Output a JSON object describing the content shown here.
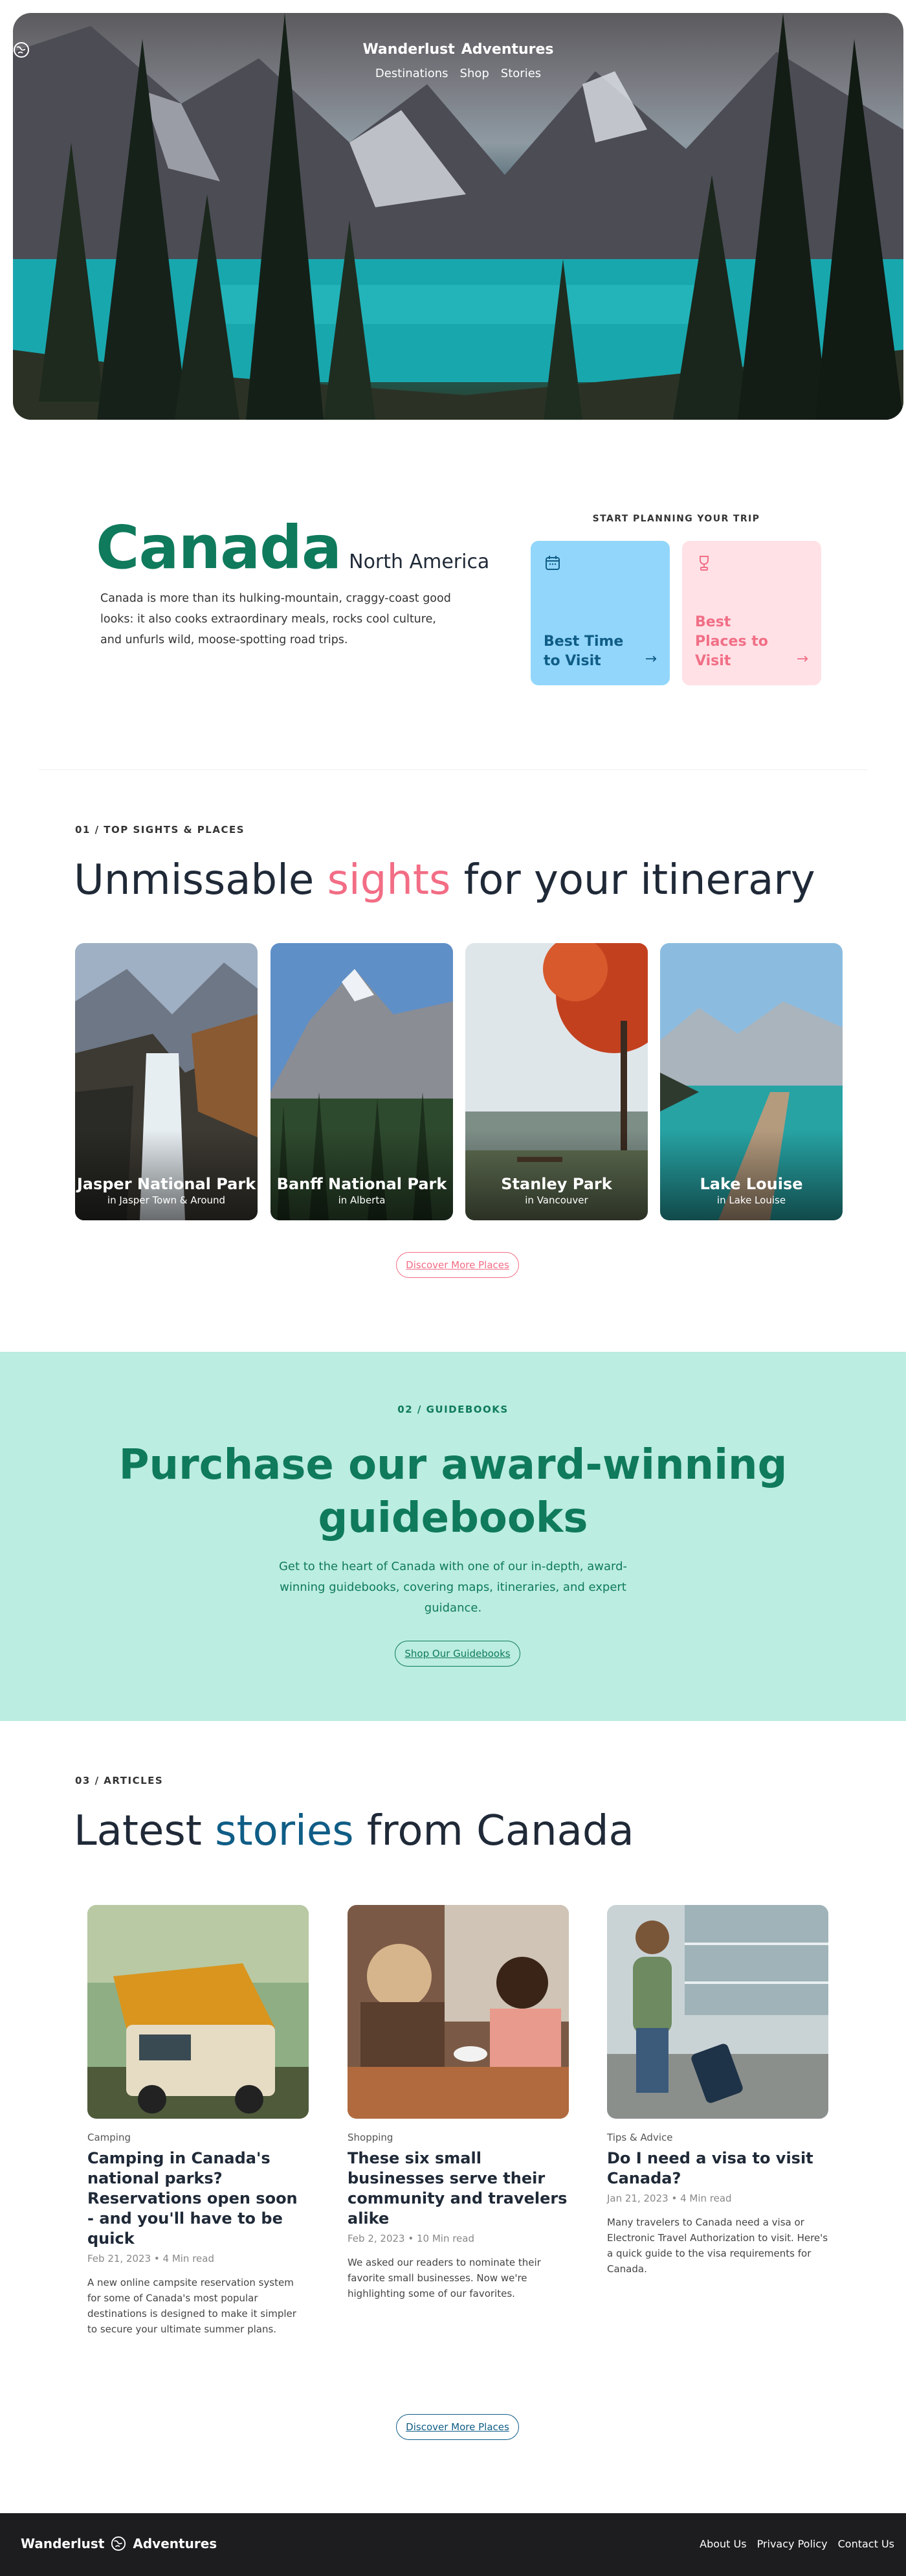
{
  "brand": {
    "name_left": "Wanderlust",
    "name_right": "Adventures"
  },
  "nav": {
    "items": [
      "Destinations",
      "Shop",
      "Stories"
    ]
  },
  "intro": {
    "country": "Canada",
    "region": "North America",
    "description": "Canada is more than its hulking-mountain, craggy-coast good looks: it also cooks extraordinary meals, rocks cool culture, and unfurls wild, moose-spotting road trips."
  },
  "planning": {
    "label": "START PLANNING YOUR TRIP",
    "cards": [
      {
        "title": "Best Time to Visit",
        "icon": "calendar-icon",
        "color": "#93d6fb"
      },
      {
        "title": "Best Places to Visit",
        "icon": "trophy-icon",
        "color": "#ffe1e6"
      }
    ]
  },
  "sights": {
    "eyebrow": "01 / TOP SIGHTS & PLACES",
    "title_before": "Unmissable ",
    "title_accent": "sights",
    "title_after": " for your itinerary",
    "items": [
      {
        "name": "Jasper National Park",
        "location": "in Jasper Town & Around"
      },
      {
        "name": "Banff National Park",
        "location": "in Alberta"
      },
      {
        "name": "Stanley Park",
        "location": "in Vancouver"
      },
      {
        "name": "Lake Louise",
        "location": "in Lake Louise"
      }
    ],
    "button": "Discover More Places"
  },
  "guidebooks": {
    "eyebrow": "02 / GUIDEBOOKS",
    "title_line1": "Purchase our award-winning",
    "title_line2": "guidebooks",
    "text": "Get to the heart of Canada with one of our in-depth, award-winning guidebooks, covering maps, itineraries, and expert guidance.",
    "button": "Shop Our Guidebooks"
  },
  "articles": {
    "eyebrow": "03 / ARTICLES",
    "title_before": "Latest ",
    "title_accent": "stories",
    "title_after": " from Canada",
    "items": [
      {
        "category": "Camping",
        "title": "Camping in Canada's national parks? Reservations open soon - and you'll have to be quick",
        "date": "Feb 21, 2023",
        "read": "4 Min read",
        "excerpt": "A new online campsite reservation system for some of Canada's most popular destinations is designed to make it simpler to secure your ultimate summer plans."
      },
      {
        "category": "Shopping",
        "title": "These six small businesses serve their community and travelers alike",
        "date": "Feb 2, 2023",
        "read": "10 Min read",
        "excerpt": "We asked our readers to nominate their favorite small businesses. Now we're highlighting some of our favorites."
      },
      {
        "category": "Tips & Advice",
        "title": "Do I need a visa to visit Canada?",
        "date": "Jan 21, 2023",
        "read": "4 Min read",
        "excerpt": "Many travelers to Canada need a visa or Electronic Travel Authorization to visit. Here's a quick guide to the visa requirements for Canada."
      }
    ],
    "button": "Discover More Places"
  },
  "footer": {
    "links": [
      "About Us",
      "Privacy Policy",
      "Contact Us"
    ]
  },
  "colors": {
    "green": "#0f7a5c",
    "pink": "#f26d85",
    "blue": "#0f5d86",
    "mint": "#bbede0",
    "footer": "#1d1d1f"
  }
}
